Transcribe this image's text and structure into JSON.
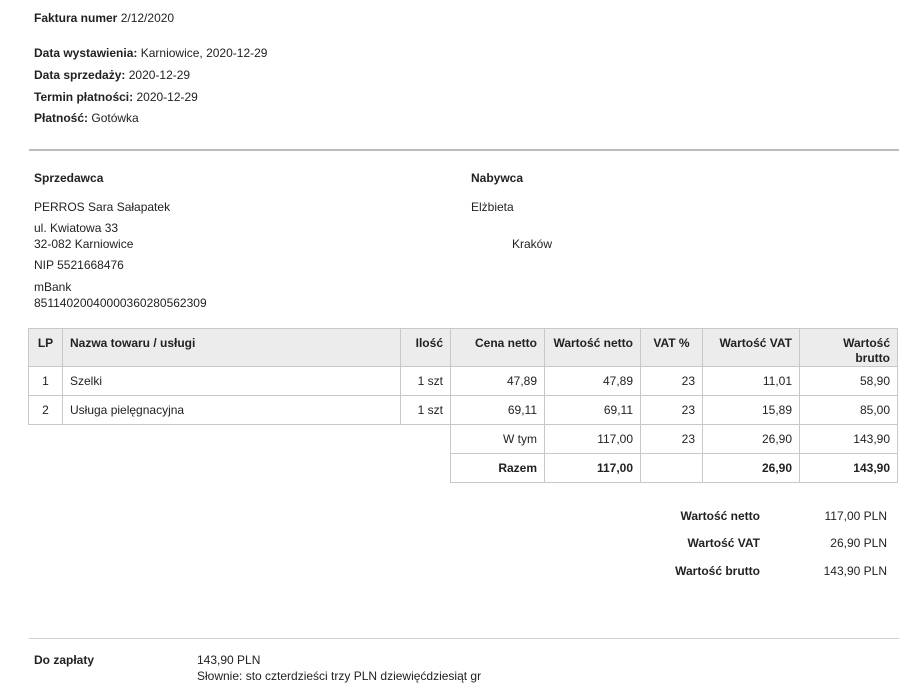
{
  "invoice": {
    "number_label": "Faktura numer",
    "number": "2/12/2020",
    "issue_label": "Data wystawienia:",
    "issue_value": "Karniowice, 2020-12-29",
    "sale_label": "Data sprzedaży:",
    "sale_value": "2020-12-29",
    "due_label": "Termin płatności:",
    "due_value": "2020-12-29",
    "payment_label": "Płatność:",
    "payment_value": "Gotówka"
  },
  "seller": {
    "heading": "Sprzedawca",
    "name": "PERROS Sara Sałapatek",
    "street": "ul. Kwiatowa 33",
    "city": "32-082 Karniowice",
    "nip": "NIP 5521668476",
    "bank": "mBank",
    "account": "85114020040000360280562309"
  },
  "buyer": {
    "heading": "Nabywca",
    "name": "Elżbieta",
    "city": "Kraków"
  },
  "table": {
    "headers": {
      "lp": "LP",
      "name": "Nazwa towaru / usługi",
      "qty": "Ilość",
      "price": "Cena netto",
      "net": "Wartość netto",
      "vat_pct": "VAT %",
      "vat_val": "Wartość VAT",
      "gross": "Wartość brutto"
    },
    "rows": [
      {
        "lp": "1",
        "name": "Szelki",
        "qty": "1 szt",
        "price": "47,89",
        "net": "47,89",
        "vat_pct": "23",
        "vat_val": "11,01",
        "gross": "58,90"
      },
      {
        "lp": "2",
        "name": "Usługa pielęgnacyjna",
        "qty": "1 szt",
        "price": "69,11",
        "net": "69,11",
        "vat_pct": "23",
        "vat_val": "15,89",
        "gross": "85,00"
      }
    ],
    "wtym": {
      "label": "W tym",
      "net": "117,00",
      "vat_pct": "23",
      "vat_val": "26,90",
      "gross": "143,90"
    },
    "razem": {
      "label": "Razem",
      "net": "117,00",
      "vat_val": "26,90",
      "gross": "143,90"
    }
  },
  "summary": {
    "net_label": "Wartość netto",
    "net_value": "117,00 PLN",
    "vat_label": "Wartość VAT",
    "vat_value": "26,90 PLN",
    "gross_label": "Wartość brutto",
    "gross_value": "143,90 PLN"
  },
  "payment_due": {
    "label": "Do zapłaty",
    "amount": "143,90 PLN",
    "words": "Słownie: sto czterdzieści trzy PLN dziewięćdziesiąt gr"
  }
}
